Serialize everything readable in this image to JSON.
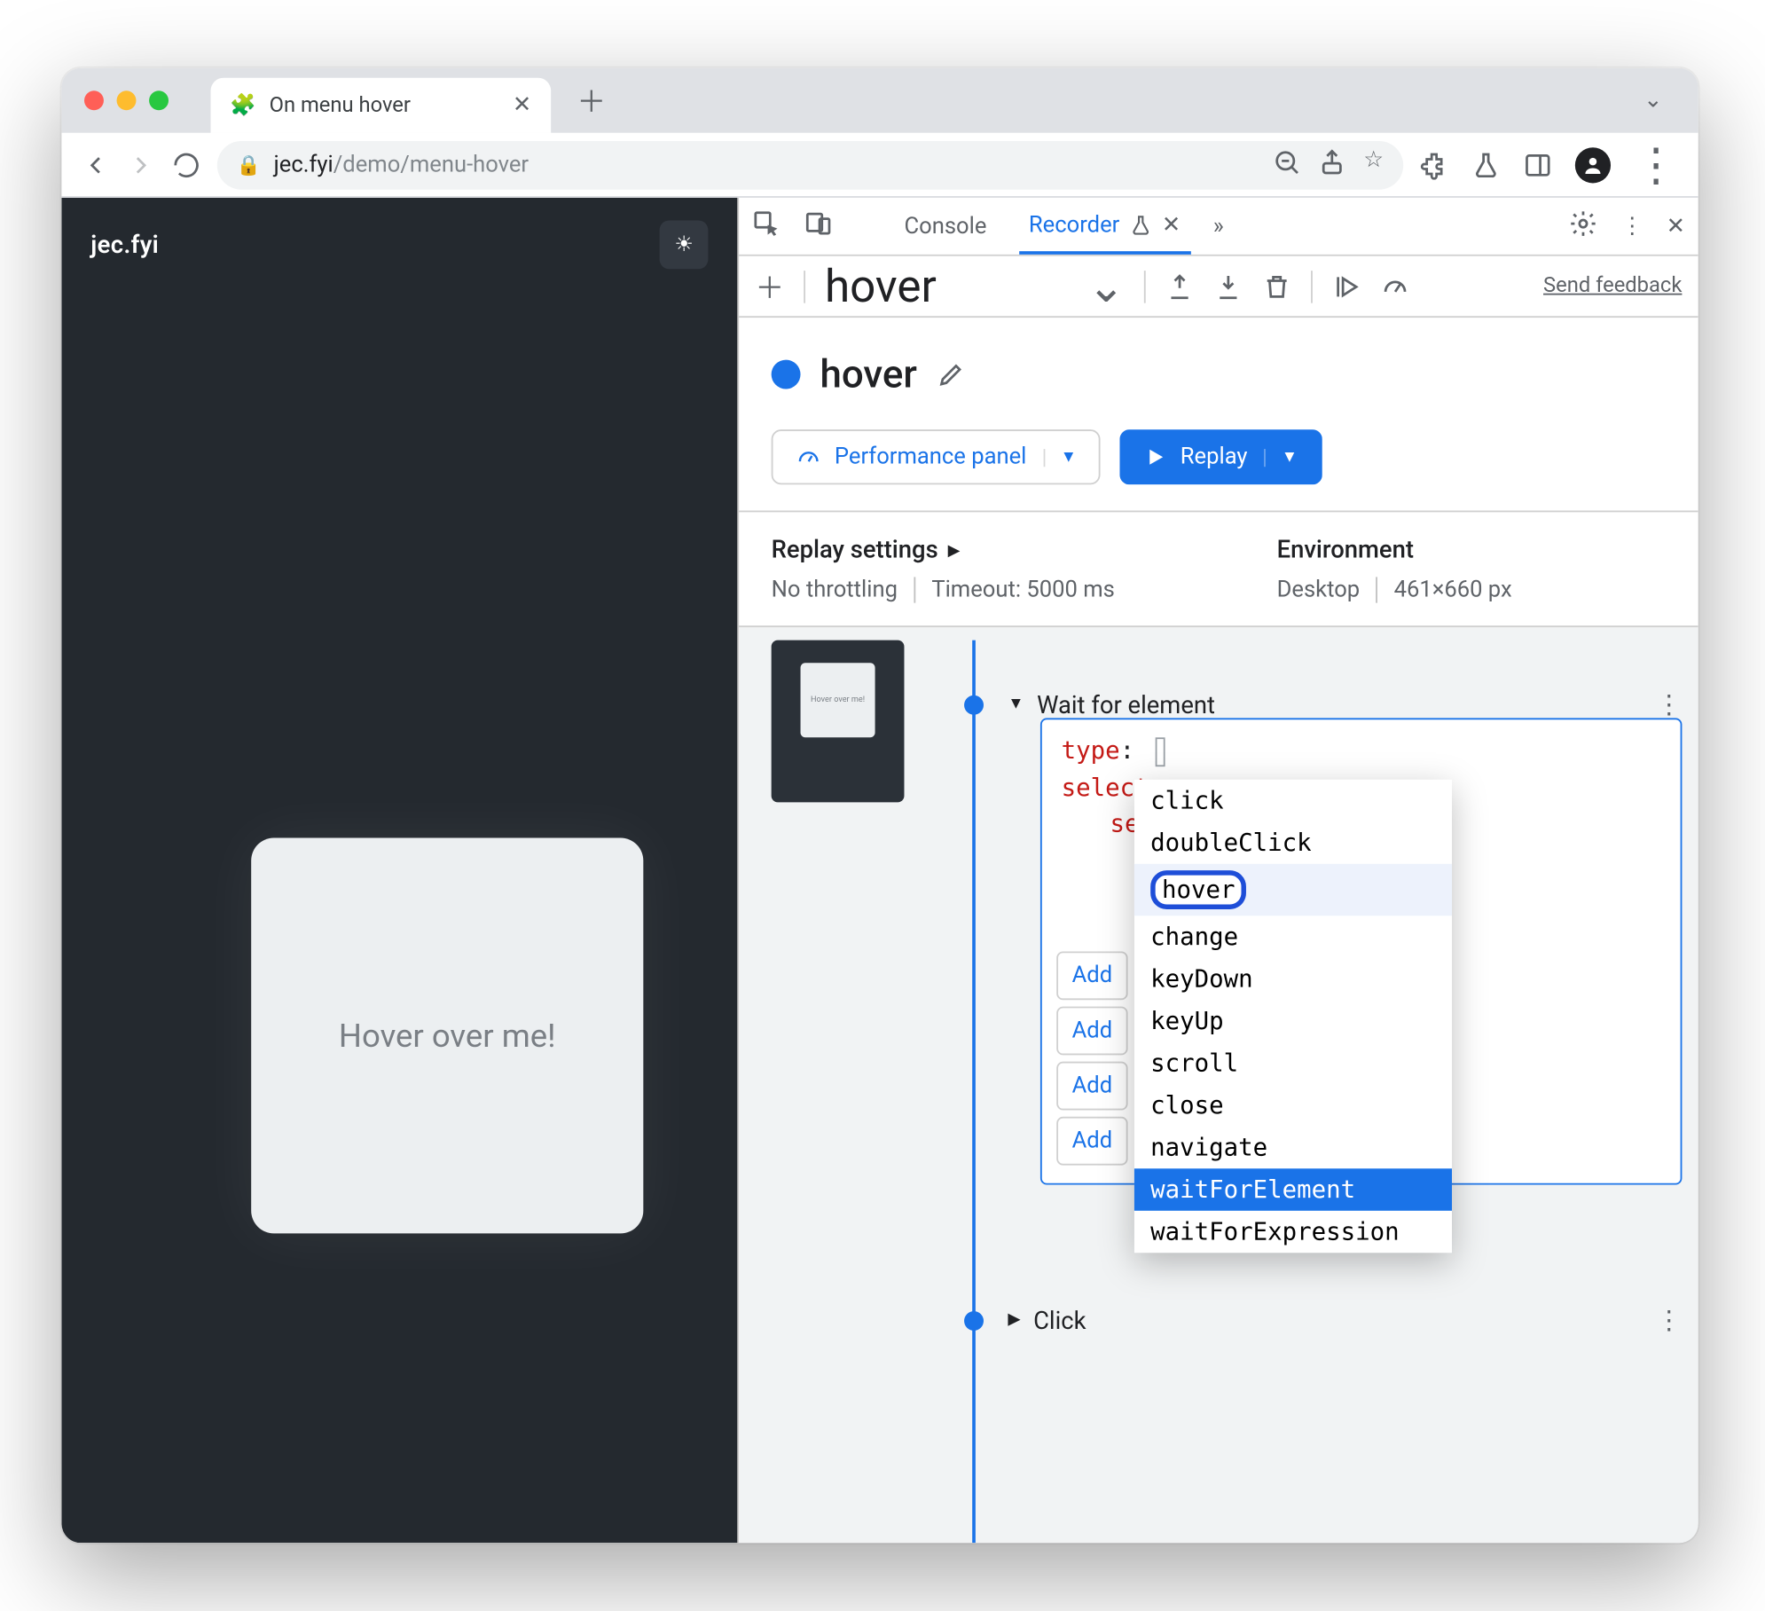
{
  "browser": {
    "tab_title": "On menu hover",
    "url_host": "jec.fyi",
    "url_path": "/demo/menu-hover"
  },
  "page": {
    "site_title": "jec.fyi",
    "card_text": "Hover over me!"
  },
  "devtools": {
    "tabs": {
      "console": "Console",
      "recorder": "Recorder"
    },
    "recording_name": "hover",
    "feedback": "Send feedback",
    "title": "hover",
    "perf_button": "Performance panel",
    "replay_button": "Replay",
    "replay_settings_label": "Replay settings",
    "throttling": "No throttling",
    "timeout": "Timeout: 5000 ms",
    "env_label": "Environment",
    "env_device": "Desktop",
    "env_size": "461×660 px",
    "step_wait": "Wait for element",
    "step_click": "Click",
    "thumb_text": "Hover over me!",
    "editor": {
      "type_key": "type",
      "selectors_key": "select",
      "sel_prefix": "sel"
    },
    "add_label": "Add",
    "type_options": [
      "click",
      "doubleClick",
      "hover",
      "change",
      "keyDown",
      "keyUp",
      "scroll",
      "close",
      "navigate",
      "waitForElement",
      "waitForExpression"
    ]
  }
}
